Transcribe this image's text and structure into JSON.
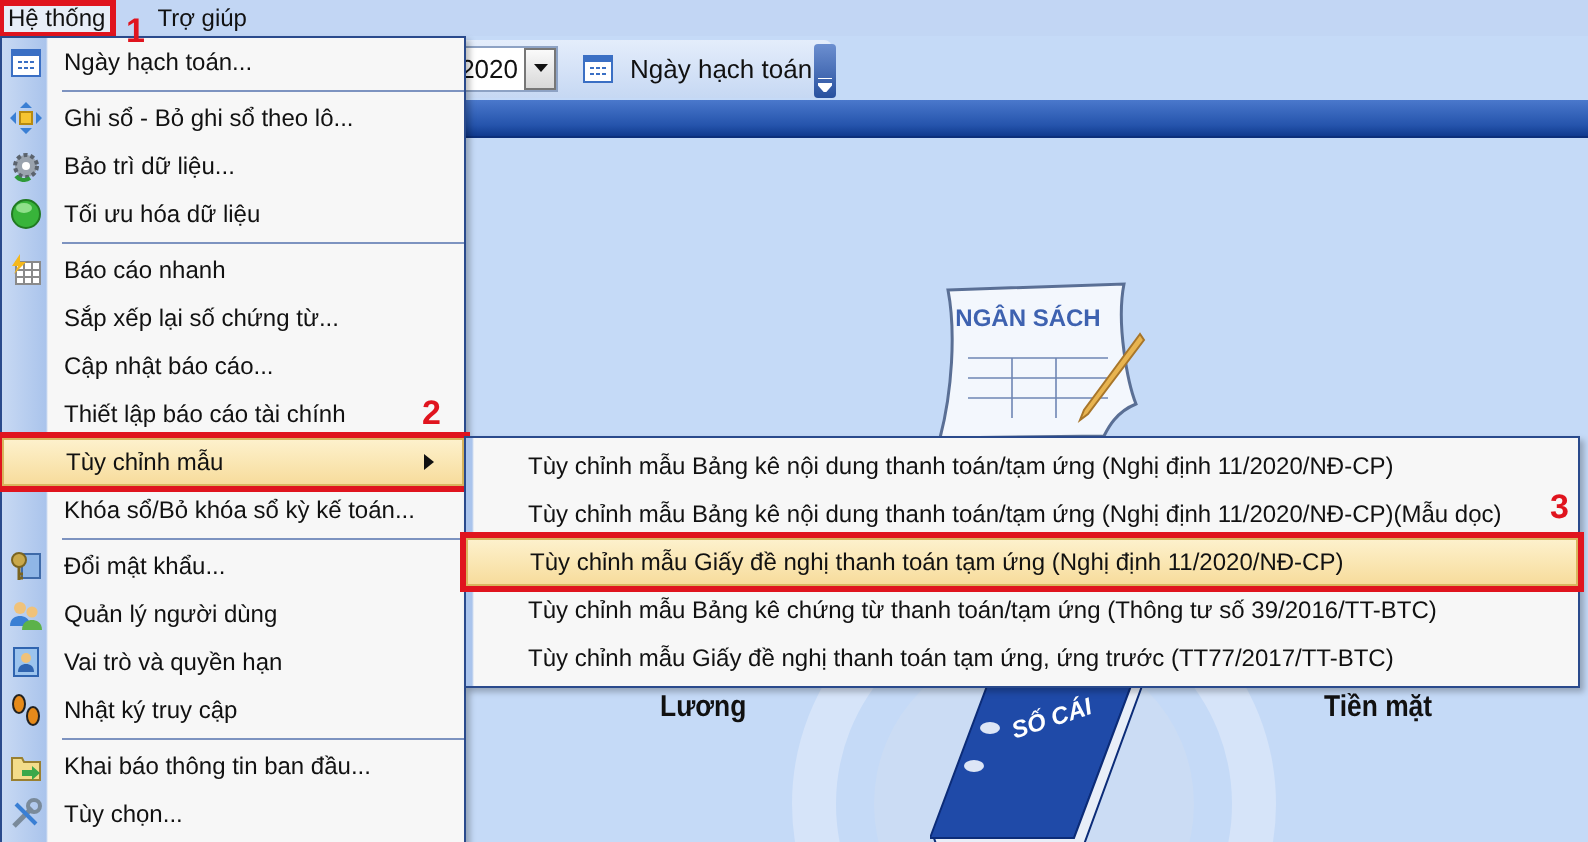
{
  "menubar": [
    {
      "label": "Hệ thống",
      "selected": true,
      "annotation": "1"
    },
    {
      "label": "Trợ giúp",
      "selected": false
    }
  ],
  "toolbar": {
    "date_value": "2020",
    "date_button": "Ngày hạch toán"
  },
  "system_menu": {
    "items": [
      {
        "kind": "item",
        "label": "Ngày hạch toán...",
        "selected": false
      },
      {
        "kind": "separator"
      },
      {
        "kind": "item",
        "label": "Ghi sổ - Bỏ ghi sổ theo lô...",
        "selected": false
      },
      {
        "kind": "item",
        "label": "Bảo trì dữ liệu...",
        "selected": false
      },
      {
        "kind": "item",
        "label": "Tối ưu hóa dữ liệu",
        "selected": false
      },
      {
        "kind": "separator"
      },
      {
        "kind": "item",
        "label": "Báo cáo nhanh",
        "selected": false
      },
      {
        "kind": "item",
        "label": "Sắp xếp lại số chứng từ...",
        "selected": false
      },
      {
        "kind": "item",
        "label": "Cập nhật báo cáo...",
        "selected": false
      },
      {
        "kind": "item",
        "label": "Thiết lập báo cáo tài chính",
        "selected": false
      },
      {
        "kind": "submenu",
        "label": "Tùy chỉnh mẫu",
        "selected": true,
        "annotation": "2"
      },
      {
        "kind": "item",
        "label": "Khóa sổ/Bỏ khóa sổ kỳ kế toán...",
        "selected": false
      },
      {
        "kind": "separator"
      },
      {
        "kind": "item",
        "label": "Đổi mật khẩu...",
        "selected": false
      },
      {
        "kind": "item",
        "label": "Quản lý người dùng",
        "selected": false
      },
      {
        "kind": "item",
        "label": "Vai trò và quyền hạn",
        "selected": false
      },
      {
        "kind": "item",
        "label": "Nhật ký truy cập",
        "selected": false
      },
      {
        "kind": "separator"
      },
      {
        "kind": "item",
        "label": "Khai báo thông tin ban đầu...",
        "selected": false
      },
      {
        "kind": "item",
        "label": "Tùy chọn...",
        "selected": false
      }
    ]
  },
  "submenu": {
    "items": [
      {
        "label": "Tùy chỉnh mẫu Bảng kê nội dung thanh toán/tạm ứng (Nghị định 11/2020/NĐ-CP)",
        "selected": false
      },
      {
        "label": "Tùy chỉnh mẫu Bảng kê nội dung thanh toán/tạm ứng (Nghị định 11/2020/NĐ-CP)(Mẫu dọc)",
        "selected": false
      },
      {
        "label": "Tùy chỉnh mẫu Giấy đề nghị thanh toán tạm ứng (Nghị định 11/2020/NĐ-CP)",
        "selected": true,
        "annotation": "3"
      },
      {
        "label": "Tùy chỉnh mẫu Bảng kê chứng từ thanh toán/tạm ứng (Thông tư số 39/2016/TT-BTC)",
        "selected": false
      },
      {
        "label": "Tùy chỉnh mẫu Giấy đề nghị thanh toán tạm ứng, ứng trước (TT77/2017/TT-BTC)",
        "selected": false
      }
    ]
  },
  "dashboard": {
    "budget_title": "NGÂN SÁCH",
    "ledger_title": "SỐ CÁI",
    "labels": [
      "Lương",
      "Tiền mặt"
    ]
  }
}
